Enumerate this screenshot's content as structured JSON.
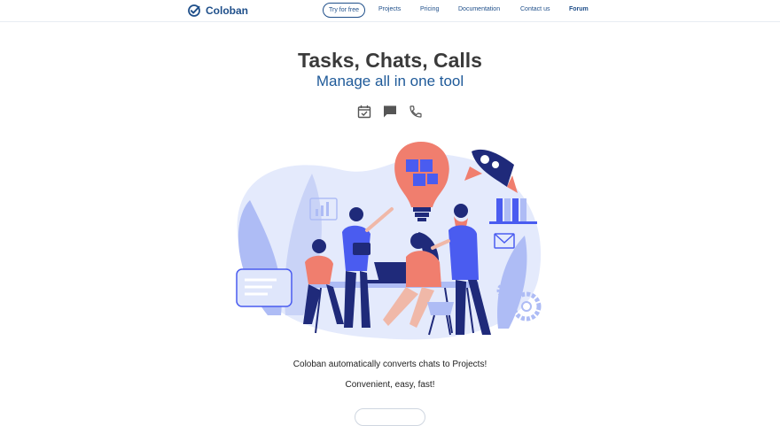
{
  "nav": {
    "logo_text": "Coloban",
    "cta_label": "Try for free",
    "links": [
      "Projects",
      "Pricing",
      "Documentation",
      "Contact us",
      "Forum"
    ]
  },
  "hero": {
    "title": "Tasks, Chats, Calls",
    "subtitle": "Manage all in one tool",
    "feature_icons": [
      "calendar-check-icon",
      "chat-bubble-icon",
      "phone-icon"
    ]
  },
  "body": {
    "tagline_1": "Coloban automatically converts chats to Projects!",
    "tagline_2": "Convenient, easy, fast!"
  },
  "colors": {
    "brand": "#1f4f8a",
    "accent_blue": "#4a5cf0",
    "accent_salmon": "#f07e6e",
    "light_blue": "#dfe6fb"
  }
}
